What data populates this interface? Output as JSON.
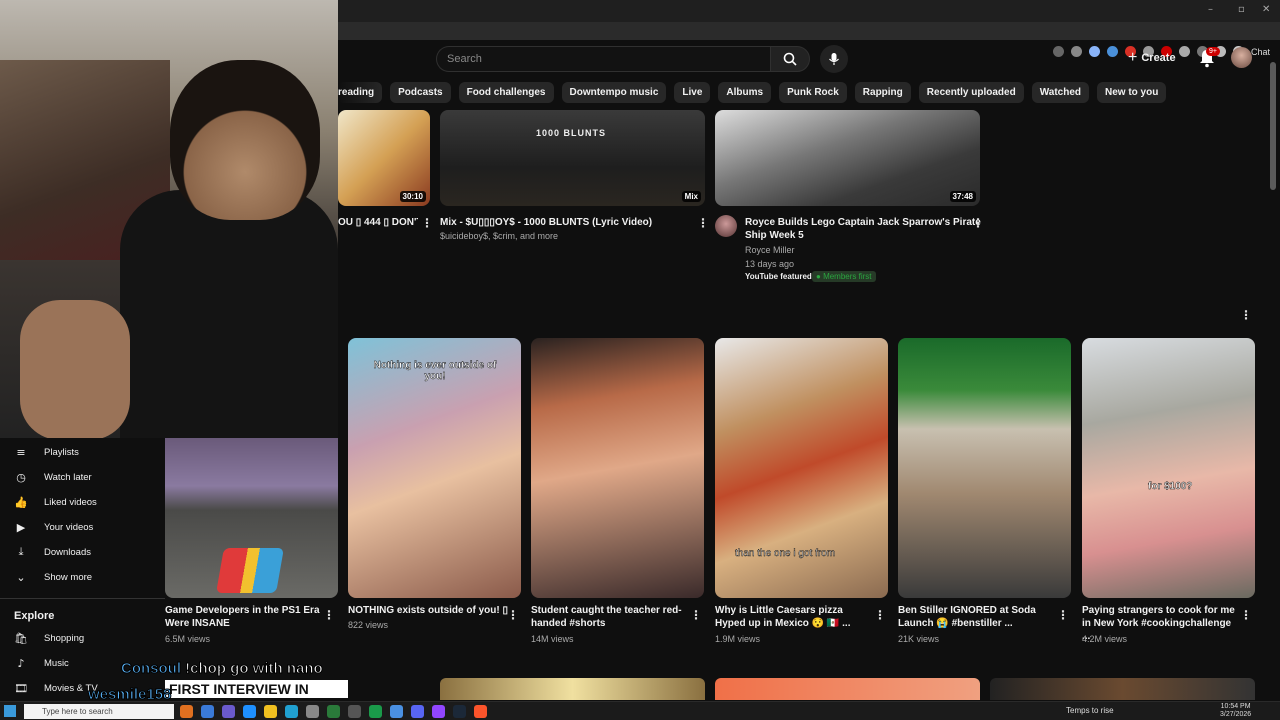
{
  "browser": {
    "window_controls": [
      "–",
      "▫",
      "✕"
    ],
    "chat_label": "Chat"
  },
  "header": {
    "search_placeholder": "Search",
    "create_label": "Create",
    "notif_badge": "9+"
  },
  "chips": [
    "reading",
    "Podcasts",
    "Food challenges",
    "Downtempo music",
    "Live",
    "Albums",
    "Punk Rock",
    "Rapping",
    "Recently uploaded",
    "Watched",
    "New to you"
  ],
  "top_videos": [
    {
      "title": "OU ▯ 444 ▯ DON'T",
      "duration": "30:10"
    },
    {
      "title": "Mix - $U▯▯▯OY$ - 1000 BLUNTS (Lyric Video)",
      "meta": "$uicideboy$, $crim, and more",
      "overlay": "1000 BLUNTS",
      "duration": "Mix"
    },
    {
      "title_line1": "Royce Builds Lego Captain Jack Sparrow's Pirate",
      "title_line2": "Ship Week 5",
      "channel": "Royce Miller",
      "age": "13 days ago",
      "featured": "YouTube featured",
      "members": "Members first",
      "duration": "37:48"
    }
  ],
  "shorts": [
    {
      "title_line1": "Game Developers in the PS1 Era",
      "title_line2": "Were INSANE",
      "views": "6.5M views"
    },
    {
      "title_line1": "NOTHING exists outside of you! ▯",
      "title_line2": "",
      "views": "822 views",
      "caption": "Nothing is ever outside of you!"
    },
    {
      "title_line1": "Student caught the teacher red-",
      "title_line2": "handed #shorts",
      "views": "14M views"
    },
    {
      "title_line1": "Why is Little Caesars pizza",
      "title_line2": "Hyped up in Mexico 😯 🇲🇽 ...",
      "views": "1.9M views",
      "caption": "than the one i got from"
    },
    {
      "title_line1": "Ben Stiller IGNORED at Soda",
      "title_line2": "Launch 😭 #benstiller ...",
      "views": "21K views"
    },
    {
      "title_line1": "Paying strangers to cook for me",
      "title_line2": "in New York #cookingchallenge ...",
      "views": "4.2M views",
      "caption": "for $100?"
    }
  ],
  "sidebar": {
    "items": [
      {
        "label": "Playlists",
        "icon": "≡"
      },
      {
        "label": "Watch later",
        "icon": "◷"
      },
      {
        "label": "Liked videos",
        "icon": "👍"
      },
      {
        "label": "Your videos",
        "icon": "▶"
      },
      {
        "label": "Downloads",
        "icon": "⤓"
      },
      {
        "label": "Show more",
        "icon": "⌄"
      }
    ],
    "explore_title": "Explore",
    "explore": [
      {
        "label": "Shopping",
        "icon": "🛍"
      },
      {
        "label": "Music",
        "icon": "♪"
      },
      {
        "label": "Movies & TV",
        "icon": "🎞"
      }
    ]
  },
  "stream_overlay": {
    "chat_user1": "Consoul",
    "chat_msg1": "!chop go with nano",
    "chat_user2": "wesmile158",
    "banner": "FIRST INTERVIEW IN"
  },
  "taskbar": {
    "search_placeholder": "Type here to search",
    "weather": "Temps to rise",
    "time": "10:54 PM",
    "date": "3/27/2026"
  }
}
